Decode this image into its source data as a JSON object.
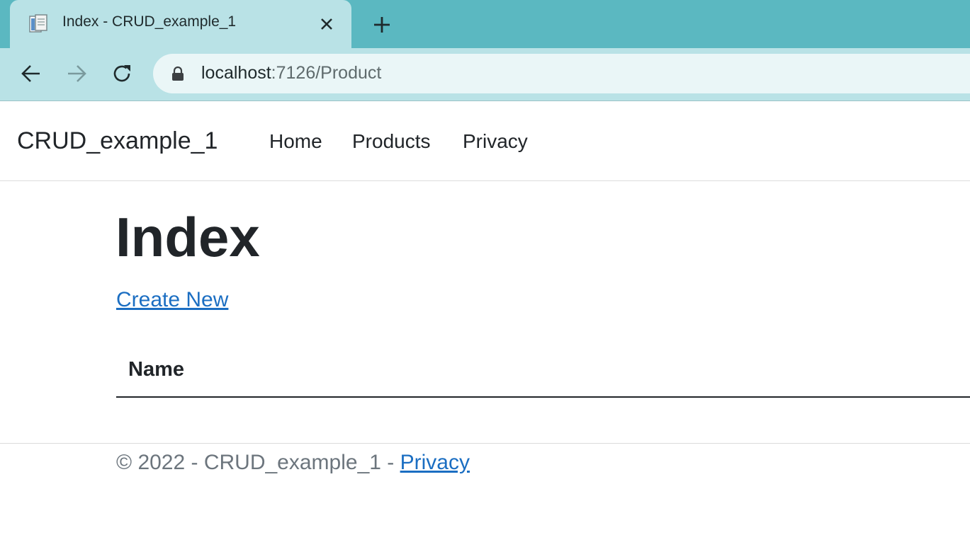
{
  "browser": {
    "tab": {
      "title": "Index - CRUD_example_1",
      "icon": "page-icon"
    },
    "url": {
      "host": "localhost",
      "path": ":7126/Product"
    },
    "colors": {
      "tabstrip": "#5bb8c1",
      "toolbar": "#b9e2e6",
      "omnibox": "#eaf6f7"
    }
  },
  "navbar": {
    "brand": "CRUD_example_1",
    "links": [
      "Home",
      "Products",
      "Privacy"
    ]
  },
  "main": {
    "title": "Index",
    "create_link": "Create New",
    "table": {
      "headers": [
        "Name"
      ],
      "rows": []
    }
  },
  "footer": {
    "text": "© 2022 - CRUD_example_1 - ",
    "link": "Privacy"
  },
  "colors": {
    "link": "#1b6ec2",
    "text": "#212529",
    "muted": "#6c757d"
  }
}
